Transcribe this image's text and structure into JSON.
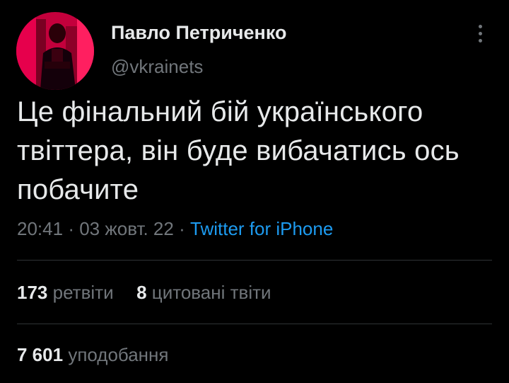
{
  "author": {
    "display_name": "Павло Петриченко",
    "handle": "@vkrainets"
  },
  "tweet": {
    "text": "Це фінальний бій українського твіттера, він буде вибачатись ось побачите",
    "time": "20:41",
    "date": "03 жовт. 22",
    "separator": "·",
    "source": "Twitter for iPhone"
  },
  "stats": {
    "retweets_count": "173",
    "retweets_label": "ретвіти",
    "quotes_count": "8",
    "quotes_label": "цитовані твіти",
    "likes_count": "7 601",
    "likes_label": "уподобання"
  },
  "colors": {
    "background": "#000000",
    "text_primary": "#e7e9ea",
    "text_secondary": "#71767b",
    "link": "#1d9bf0",
    "divider": "#2f3336",
    "avatar_tint": "#e0004a"
  },
  "icons": {
    "more": "more-vertical-icon"
  }
}
